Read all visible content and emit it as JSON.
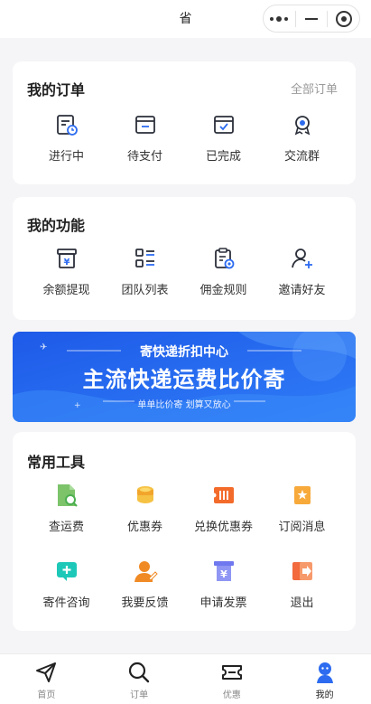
{
  "topbar": {
    "title": "省"
  },
  "orders": {
    "title": "我的订单",
    "all_link": "全部订单",
    "items": [
      {
        "label": "进行中",
        "icon": "in-progress-icon"
      },
      {
        "label": "待支付",
        "icon": "pending-payment-icon"
      },
      {
        "label": "已完成",
        "icon": "completed-icon"
      },
      {
        "label": "交流群",
        "icon": "group-badge-icon"
      }
    ]
  },
  "functions": {
    "title": "我的功能",
    "items": [
      {
        "label": "余额提现",
        "icon": "withdraw-icon"
      },
      {
        "label": "团队列表",
        "icon": "team-list-icon"
      },
      {
        "label": "佣金规则",
        "icon": "commission-rules-icon"
      },
      {
        "label": "邀请好友",
        "icon": "invite-friend-icon"
      }
    ]
  },
  "banner": {
    "line1": "寄快递折扣中心",
    "line2": "主流快递运费比价寄",
    "line3": "单单比价寄 划算又放心"
  },
  "tools": {
    "title": "常用工具",
    "items": [
      {
        "label": "查运费",
        "icon": "check-shipping-icon"
      },
      {
        "label": "优惠券",
        "icon": "coupon-icon"
      },
      {
        "label": "兑换优惠券",
        "icon": "redeem-coupon-icon"
      },
      {
        "label": "订阅消息",
        "icon": "subscribe-message-icon"
      },
      {
        "label": "寄件咨询",
        "icon": "consult-icon"
      },
      {
        "label": "我要反馈",
        "icon": "feedback-icon"
      },
      {
        "label": "申请发票",
        "icon": "invoice-icon"
      },
      {
        "label": "退出",
        "icon": "logout-icon"
      }
    ]
  },
  "tabbar": [
    {
      "label": "首页",
      "icon": "paper-plane-icon"
    },
    {
      "label": "订单",
      "icon": "search-icon"
    },
    {
      "label": "优惠",
      "icon": "ticket-icon"
    },
    {
      "label": "我的",
      "icon": "user-avatar-icon"
    }
  ],
  "colors": {
    "blue": "#2d6cf0",
    "green": "#4caf50",
    "orange": "#f08c2e",
    "dark": "#2b2f3a",
    "teal": "#1ec8b8",
    "purple": "#7b84f2",
    "red": "#f05a3c"
  }
}
